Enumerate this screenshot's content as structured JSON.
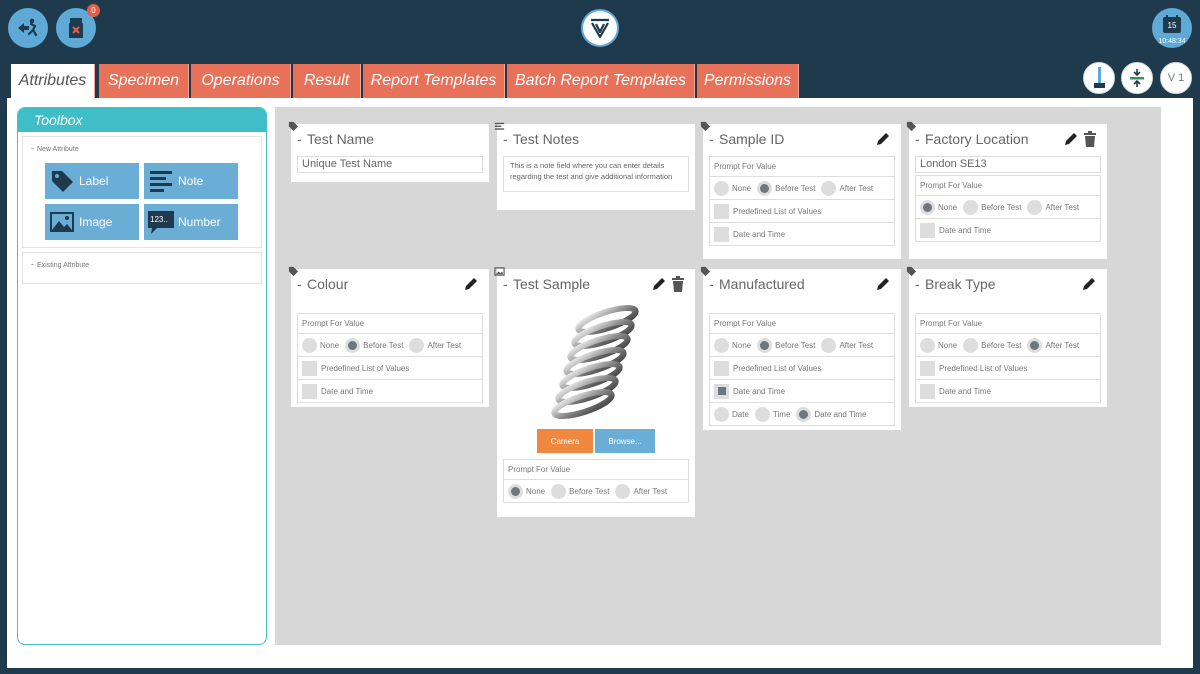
{
  "header": {
    "notification_count": "0",
    "calendar_day": "15",
    "clock_time": "10:48:34"
  },
  "tabs": [
    {
      "label": "Attributes"
    },
    {
      "label": "Specimen"
    },
    {
      "label": "Operations"
    },
    {
      "label": "Result"
    },
    {
      "label": "Report Templates"
    },
    {
      "label": "Batch Report Templates"
    },
    {
      "label": "Permissions"
    }
  ],
  "toolbar_right": {
    "version_label": "V 1"
  },
  "toolbox": {
    "title": "Toolbox",
    "new_attribute": "New Attribute",
    "existing_attribute": "Existing Attribute",
    "tools": [
      {
        "label": "Label",
        "icon": "tag-icon"
      },
      {
        "label": "Note",
        "icon": "lines-icon"
      },
      {
        "label": "Image",
        "icon": "image-icon"
      },
      {
        "label": "Number",
        "icon": "number-icon"
      }
    ]
  },
  "labels": {
    "prompt_for_value": "Prompt For Value",
    "none": "None",
    "before_test": "Before Test",
    "after_test": "After Test",
    "predefined": "Predefined List of Values",
    "date_and_time": "Date and Time",
    "date": "Date",
    "time": "Time"
  },
  "cards": {
    "test_name": {
      "title": "Test Name",
      "placeholder": "Unique Test Name"
    },
    "test_notes": {
      "title": "Test Notes",
      "note": "This is a note field where you can enter details regarding the test and give additional information"
    },
    "sample_id": {
      "title": "Sample ID",
      "prompt": "before_test"
    },
    "factory_location": {
      "title": "Factory Location",
      "value": "London SE13",
      "prompt": "none"
    },
    "colour": {
      "title": "Colour",
      "prompt": "before_test"
    },
    "test_sample": {
      "title": "Test Sample",
      "camera": "Camera",
      "browse": "Browse...",
      "prompt": "none"
    },
    "manufactured": {
      "title": "Manufactured",
      "prompt": "before_test",
      "date_and_time_checked": true,
      "date_mode": "date_and_time"
    },
    "break_type": {
      "title": "Break Type",
      "prompt": "after_test"
    }
  }
}
